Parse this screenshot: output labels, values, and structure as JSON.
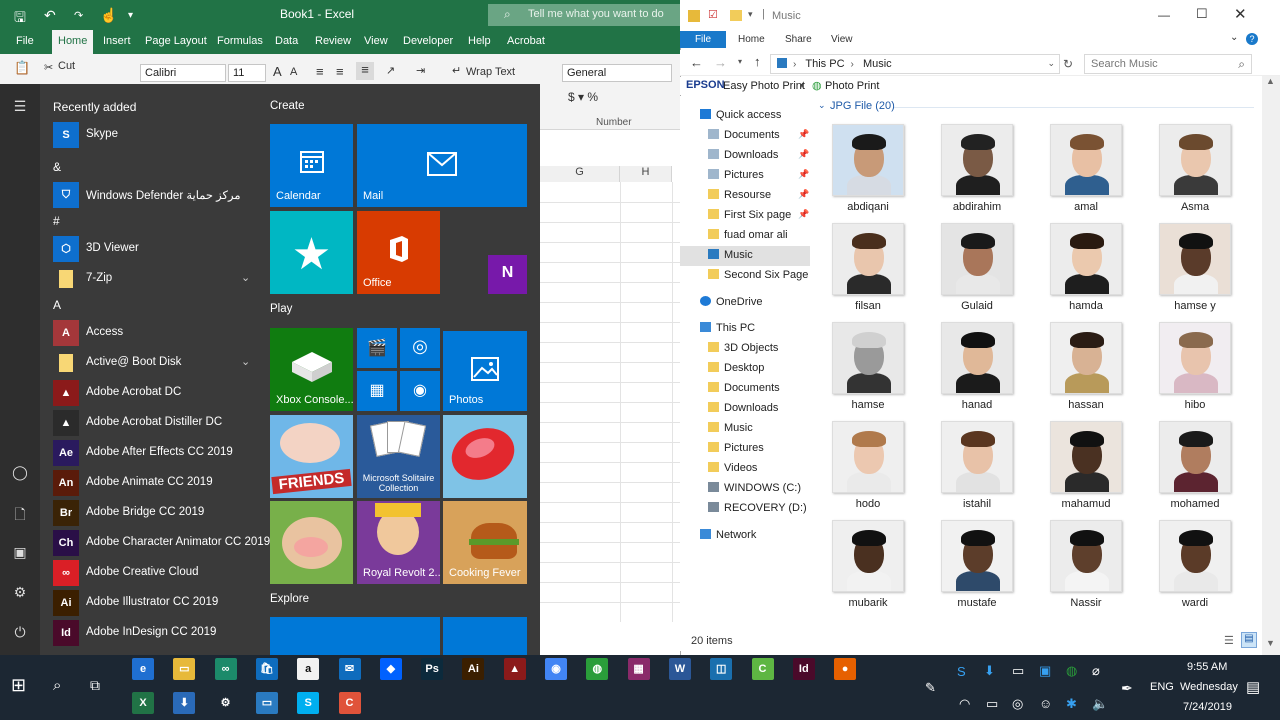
{
  "excel": {
    "doc_title": "Book1 - Excel",
    "tell_me": "Tell me what you want to do",
    "tabs": [
      "File",
      "Home",
      "Insert",
      "Page Layout",
      "Formulas",
      "Data",
      "Review",
      "View",
      "Developer",
      "Help",
      "Acrobat"
    ],
    "cut_label": "Cut",
    "font_name": "Calibri",
    "font_size": "11",
    "wrap_text": "Wrap Text",
    "number_format": "General",
    "number_group": "Number",
    "col_g": "G",
    "col_h": "H"
  },
  "start": {
    "recently_added": "Recently added",
    "recent_app": "Skype",
    "groups": [
      {
        "letter": "&",
        "apps": [
          {
            "name": "Windows Defender مركز حماية",
            "icon": "shield-icon",
            "color": "#0e6fce"
          }
        ]
      },
      {
        "letter": "#",
        "apps": [
          {
            "name": "3D Viewer",
            "icon": "cube-icon",
            "color": "#0e6fce"
          },
          {
            "name": "7-Zip",
            "icon": "folder-icon",
            "color": "#f8d775",
            "expand": "⌄"
          }
        ]
      },
      {
        "letter": "A",
        "apps": [
          {
            "name": "Access",
            "icon": "A",
            "color": "#a4373a"
          },
          {
            "name": "Active@ Boot Disk",
            "icon": "folder-icon",
            "color": "#f8d775",
            "expand": "⌄"
          },
          {
            "name": "Adobe Acrobat DC",
            "icon": "acrobat-icon",
            "color": "#8b1a1a"
          },
          {
            "name": "Adobe Acrobat Distiller DC",
            "icon": "acrobat-icon",
            "color": "#2b2b2b"
          },
          {
            "name": "Adobe After Effects CC 2019",
            "icon": "Ae",
            "color": "#2a1a5e"
          },
          {
            "name": "Adobe Animate CC 2019",
            "icon": "An",
            "color": "#5a1b0a"
          },
          {
            "name": "Adobe Bridge CC 2019",
            "icon": "Br",
            "color": "#3a2306"
          },
          {
            "name": "Adobe Character Animator CC 2019",
            "icon": "Ch",
            "color": "#2a0f47"
          },
          {
            "name": "Adobe Creative Cloud",
            "icon": "cc-icon",
            "color": "#da1f26"
          },
          {
            "name": "Adobe Illustrator CC 2019",
            "icon": "Ai",
            "color": "#3b1f00"
          },
          {
            "name": "Adobe InDesign CC 2019",
            "icon": "Id",
            "color": "#4a0a2a"
          }
        ]
      }
    ],
    "group_create": "Create",
    "group_play": "Play",
    "group_explore": "Explore",
    "tiles": {
      "calendar": "Calendar",
      "mail": "Mail",
      "office": "Office",
      "xbox": "Xbox Console...",
      "photos": "Photos",
      "solitaire": "Microsoft Solitaire Collection",
      "royal_revolt": "Royal Revolt 2...",
      "cooking_fever": "Cooking Fever",
      "friends_word": "FRIENDS"
    }
  },
  "explorer": {
    "title": "Music",
    "tabs": [
      "File",
      "Home",
      "Share",
      "View"
    ],
    "path": [
      "This PC",
      "Music"
    ],
    "search_placeholder": "Search Music",
    "epson": "EPSON",
    "easy_photo_print": "Easy Photo Print",
    "photo_print": "Photo Print",
    "group_header": "JPG File (20)",
    "status": "20 items",
    "nav": {
      "quick_access": "Quick access",
      "quick_items": [
        "Documents",
        "Downloads",
        "Pictures",
        "Resourse",
        "First Six page",
        "fuad omar ali",
        "Music",
        "Second Six Page"
      ],
      "onedrive": "OneDrive",
      "this_pc": "This PC",
      "pc_items": [
        "3D Objects",
        "Desktop",
        "Documents",
        "Downloads",
        "Music",
        "Pictures",
        "Videos",
        "WINDOWS (C:)",
        "RECOVERY (D:)"
      ],
      "network": "Network"
    },
    "files": [
      {
        "name": "abdiqani",
        "bg": "#cfe0f0",
        "skin": "#c89a78",
        "hair": "#1a1a1a",
        "shirt": "#d6dbe3"
      },
      {
        "name": "abdirahim",
        "bg": "#ececec",
        "skin": "#7a5a45",
        "hair": "#222",
        "shirt": "#1f1f1f"
      },
      {
        "name": "amal",
        "bg": "#ececec",
        "skin": "#e8c0a4",
        "hair": "#7a5233",
        "shirt": "#2f5f8f"
      },
      {
        "name": "Asma",
        "bg": "#ececec",
        "skin": "#eac7ae",
        "hair": "#6b4a2e",
        "shirt": "#3a3a3a"
      },
      {
        "name": "filsan",
        "bg": "#ececec",
        "skin": "#e9c6ad",
        "hair": "#4a2f1d",
        "shirt": "#2a2a2a"
      },
      {
        "name": "Gulaid",
        "bg": "#e4e4e4",
        "skin": "#a9765a",
        "hair": "#1a1a1a",
        "shirt": "#e8e8e8"
      },
      {
        "name": "hamda",
        "bg": "#ececec",
        "skin": "#ebc9ae",
        "hair": "#2a1a10",
        "shirt": "#1e1e1e"
      },
      {
        "name": "hamse y",
        "bg": "#eadfd6",
        "skin": "#5a3b2a",
        "hair": "#111",
        "shirt": "#f1f1f1"
      },
      {
        "name": "hamse",
        "bg": "#e8e8e8",
        "skin": "#9a9a9a",
        "hair": "#d0d0d0",
        "shirt": "#333"
      },
      {
        "name": "hanad",
        "bg": "#e8e8e8",
        "skin": "#e0b898",
        "hair": "#111",
        "shirt": "#1b1b1b"
      },
      {
        "name": "hassan",
        "bg": "#efefef",
        "skin": "#d8b294",
        "hair": "#2a1c14",
        "shirt": "#b89a5a"
      },
      {
        "name": "hibo",
        "bg": "#f1edf1",
        "skin": "#e8c4ad",
        "hair": "#8a6a4e",
        "shirt": "#d9b8c4"
      },
      {
        "name": "hodo",
        "bg": "#efefef",
        "skin": "#ecc8b0",
        "hair": "#b07a4c",
        "shirt": "#eaeaea"
      },
      {
        "name": "istahil",
        "bg": "#efefef",
        "skin": "#e8c2a8",
        "hair": "#5a3620",
        "shirt": "#e2e2e2"
      },
      {
        "name": "mahamud",
        "bg": "#ebe4dd",
        "skin": "#4a3122",
        "hair": "#111",
        "shirt": "#2a2a2a"
      },
      {
        "name": "mohamed",
        "bg": "#ececec",
        "skin": "#b07d5f",
        "hair": "#1a1a1a",
        "shirt": "#5c2430"
      },
      {
        "name": "mubarik",
        "bg": "#efefef",
        "skin": "#4a3020",
        "hair": "#111",
        "shirt": "#f2f2f2"
      },
      {
        "name": "mustafe",
        "bg": "#f1f1f1",
        "skin": "#5c3d2a",
        "hair": "#111",
        "shirt": "#2e4a6a"
      },
      {
        "name": "Nassir",
        "bg": "#ececec",
        "skin": "#5e3f2c",
        "hair": "#111",
        "shirt": "#f4f4f4"
      },
      {
        "name": "wardi",
        "bg": "#f0f0f0",
        "skin": "#5b3b28",
        "hair": "#111",
        "shirt": "#e9e9e9"
      }
    ]
  },
  "taskbar": {
    "time": "9:55 AM",
    "day": "Wednesday",
    "date": "7/24/2019",
    "lang": "ENG",
    "row1": [
      {
        "label": "e",
        "name": "edge-icon",
        "color": "#1f6fd1"
      },
      {
        "label": "▭",
        "name": "file-explorer-icon",
        "color": "#e7b93a"
      },
      {
        "label": "∞",
        "name": "infinity-app-icon",
        "color": "#1c8a6a"
      },
      {
        "label": "🛍",
        "name": "store-icon",
        "color": "#0f6cbd"
      },
      {
        "label": "a",
        "name": "amazon-icon",
        "color": "#f2f2f2"
      },
      {
        "label": "✉",
        "name": "mail-icon",
        "color": "#0f6cbd"
      },
      {
        "label": "◆",
        "name": "dropbox-icon",
        "color": "#0061fe"
      },
      {
        "label": "Ps",
        "name": "photoshop-icon",
        "color": "#0c2a3c"
      },
      {
        "label": "Ai",
        "name": "illustrator-icon",
        "color": "#3b1f00"
      },
      {
        "label": "▲",
        "name": "acrobat-icon",
        "color": "#8b1a1a"
      },
      {
        "label": "◉",
        "name": "chrome-icon",
        "color": "#4285f4"
      },
      {
        "label": "◍",
        "name": "globe-app-icon",
        "color": "#2a9d3a"
      },
      {
        "label": "▦",
        "name": "winrar-icon",
        "color": "#8a2a6a"
      },
      {
        "label": "W",
        "name": "word-icon",
        "color": "#2b5797"
      },
      {
        "label": "◫",
        "name": "sketch-app-icon",
        "color": "#1a6fae"
      },
      {
        "label": "C",
        "name": "camtasia-icon",
        "color": "#5eb643"
      },
      {
        "label": "Id",
        "name": "indesign-icon",
        "color": "#4a0a2a"
      },
      {
        "label": "●",
        "name": "firefox-icon",
        "color": "#e66000"
      }
    ],
    "row2": [
      {
        "label": "X",
        "name": "excel-icon",
        "color": "#217346"
      },
      {
        "label": "⬇",
        "name": "downloader-icon",
        "color": "#2a6ab8"
      },
      {
        "label": "⚙",
        "name": "settings-icon",
        "color": "#1c2733"
      },
      {
        "label": "▭",
        "name": "remote-desktop-icon",
        "color": "#2a7ac0"
      },
      {
        "label": "S",
        "name": "skype-icon",
        "color": "#00aff0"
      },
      {
        "label": "C",
        "name": "capture-app-icon",
        "color": "#e0533a"
      }
    ]
  }
}
